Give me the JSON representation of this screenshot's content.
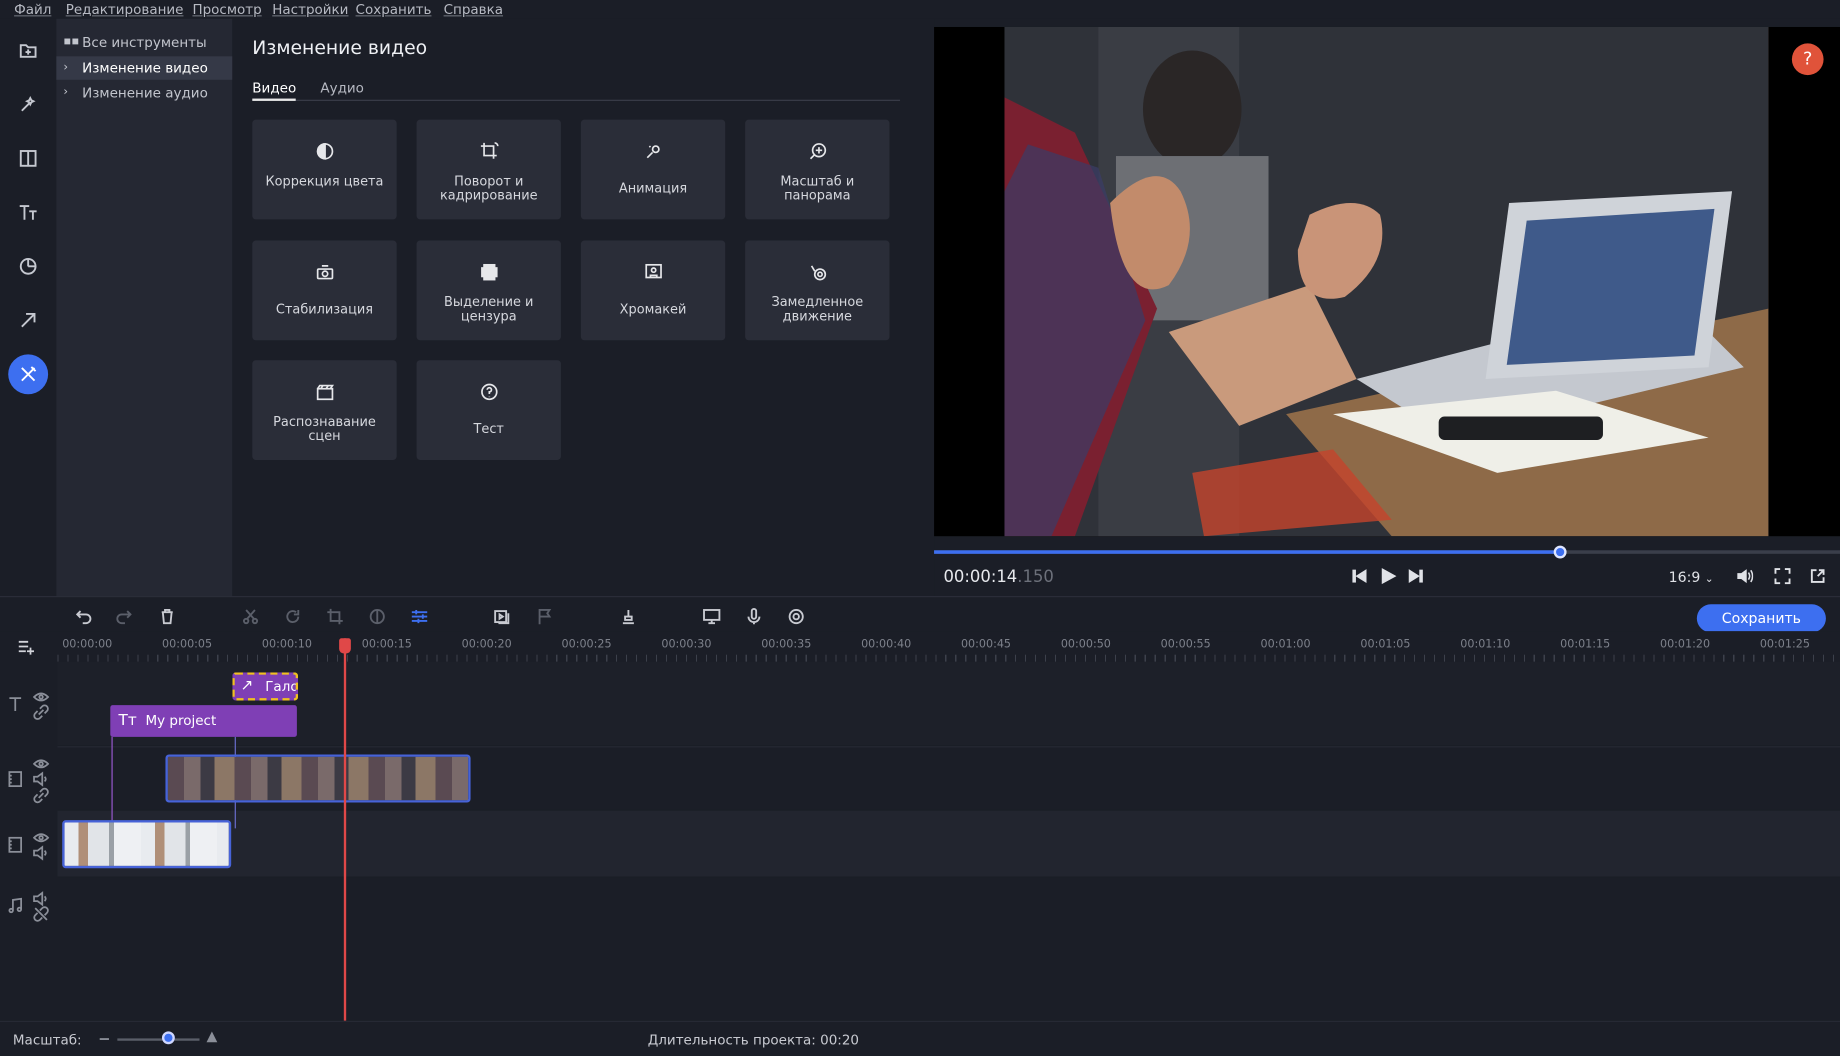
{
  "menu": {
    "file": "Файл",
    "edit": "Редактирование",
    "view": "Просмотр",
    "settings": "Настройки",
    "save": "Сохранить",
    "help": "Справка"
  },
  "sidenav": {
    "items": [
      {
        "label": "Все инструменты"
      },
      {
        "label": "Изменение видео"
      },
      {
        "label": "Изменение аудио"
      }
    ]
  },
  "panel": {
    "title": "Изменение видео",
    "tabs": {
      "video": "Видео",
      "audio": "Аудио"
    },
    "tools": [
      {
        "label": "Коррекция цвета",
        "icon": "color-correction-icon"
      },
      {
        "label": "Поворот и кадрирование",
        "icon": "crop-rotate-icon"
      },
      {
        "label": "Анимация",
        "icon": "animation-icon"
      },
      {
        "label": "Масштаб и панорама",
        "icon": "zoom-pan-icon"
      },
      {
        "label": "Стабилизация",
        "icon": "stabilization-icon"
      },
      {
        "label": "Выделение и цензура",
        "icon": "censor-icon"
      },
      {
        "label": "Хромакей",
        "icon": "chroma-key-icon"
      },
      {
        "label": "Замедленное движение",
        "icon": "slow-motion-icon"
      },
      {
        "label": "Распознавание сцен",
        "icon": "scene-detection-icon"
      },
      {
        "label": "Тест",
        "icon": "test-icon"
      }
    ]
  },
  "player": {
    "timecode": "00:00:14",
    "timecode_ms": ".150",
    "aspect": "16:9",
    "help": "?",
    "progress": 0.69
  },
  "toolbar": {
    "save_label": "Сохранить"
  },
  "ruler": {
    "ticks": [
      "00:00:00",
      "00:00:05",
      "00:00:10",
      "00:00:15",
      "00:00:20",
      "00:00:25",
      "00:00:30",
      "00:00:35",
      "00:00:40",
      "00:00:45",
      "00:00:50",
      "00:00:55",
      "00:01:00",
      "00:01:05",
      "00:01:10",
      "00:01:15",
      "00:01:20",
      "00:01:25"
    ]
  },
  "clips": {
    "title": "My project",
    "animation": "Гало"
  },
  "status": {
    "zoom_label": "Масштаб:",
    "duration": "Длительность проекта: 00:20"
  },
  "colors": {
    "accent": "#3d6ff0",
    "title_clip": "#7f3fb5",
    "playhead": "#e04848",
    "help": "#e0533a"
  }
}
